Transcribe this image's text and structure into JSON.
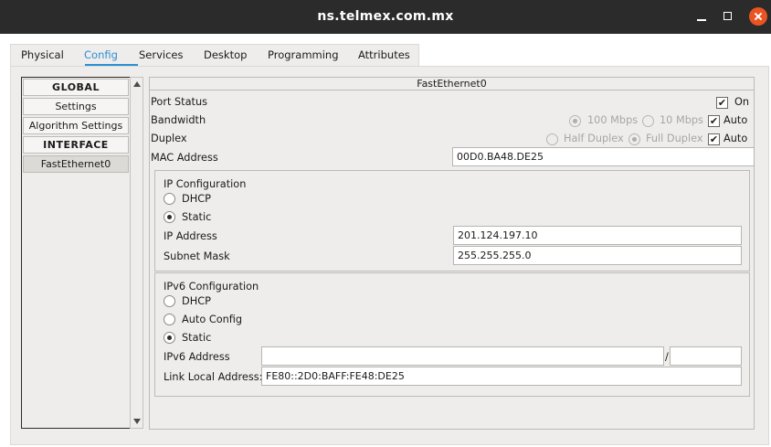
{
  "window": {
    "title": "ns.telmex.com.mx"
  },
  "tabs": [
    {
      "label": "Physical"
    },
    {
      "label": "Config"
    },
    {
      "label": "Services"
    },
    {
      "label": "Desktop"
    },
    {
      "label": "Programming"
    },
    {
      "label": "Attributes"
    }
  ],
  "active_tab": "Config",
  "sidebar": {
    "items": [
      {
        "label": "GLOBAL",
        "kind": "header"
      },
      {
        "label": "Settings",
        "kind": "item"
      },
      {
        "label": "Algorithm Settings",
        "kind": "item"
      },
      {
        "label": "INTERFACE",
        "kind": "header"
      },
      {
        "label": "FastEthernet0",
        "kind": "item",
        "selected": true
      }
    ]
  },
  "panel": {
    "title": "FastEthernet0",
    "port_status": {
      "label": "Port Status",
      "on_label": "On",
      "on_checked": true
    },
    "bandwidth": {
      "label": "Bandwidth",
      "opt1": "100 Mbps",
      "opt2": "10 Mbps",
      "selected": "100 Mbps",
      "auto_label": "Auto",
      "auto_checked": true
    },
    "duplex": {
      "label": "Duplex",
      "opt1": "Half Duplex",
      "opt2": "Full Duplex",
      "selected": "Full Duplex",
      "auto_label": "Auto",
      "auto_checked": true
    },
    "mac": {
      "label": "MAC Address",
      "value": "00D0.BA48.DE25"
    },
    "ip_config": {
      "title": "IP Configuration",
      "dhcp_label": "DHCP",
      "static_label": "Static",
      "mode": "Static",
      "ip_label": "IP Address",
      "ip_value": "201.124.197.10",
      "mask_label": "Subnet Mask",
      "mask_value": "255.255.255.0"
    },
    "ipv6_config": {
      "title": "IPv6 Configuration",
      "dhcp_label": "DHCP",
      "auto_label": "Auto Config",
      "static_label": "Static",
      "mode": "Static",
      "addr_label": "IPv6 Address",
      "addr_value": "",
      "prefix_sep": "/",
      "prefix_value": "",
      "link_local_label": "Link Local Address:",
      "link_local_value": "FE80::2D0:BAFF:FE48:DE25"
    }
  },
  "icons": [
    "minimize-icon",
    "maximize-icon",
    "close-icon",
    "scroll-up-arrow-icon",
    "scroll-down-arrow-icon"
  ],
  "colors": {
    "accent": "#2a8fd4",
    "titlebar": "#2b2b2b",
    "close": "#e95420",
    "panel_bg": "#efedeb"
  }
}
